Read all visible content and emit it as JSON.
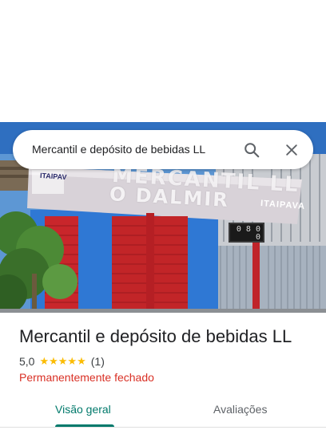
{
  "search": {
    "query": "Mercantil e depósito de bebidas LL"
  },
  "photo": {
    "sign_line1": "MERCANTIL LL",
    "sign_line2": "O DALMIR",
    "sign_brand": "ITAIPAVA",
    "sign_brand_left": "ITAIPAV",
    "meter_display": "0 8 0 0"
  },
  "place": {
    "name": "Mercantil e depósito de bebidas LL",
    "rating": "5,0",
    "stars": "★★★★★",
    "reviews_count": "(1)",
    "status": "Permanentemente fechado"
  },
  "tabs": [
    {
      "label": "Visão geral",
      "active": true
    },
    {
      "label": "Avaliações",
      "active": false
    }
  ],
  "colors": {
    "accent": "#00796b",
    "closed": "#d93025",
    "star": "#fbbc04"
  },
  "icons": {
    "search": "search-icon",
    "close": "close-icon"
  }
}
